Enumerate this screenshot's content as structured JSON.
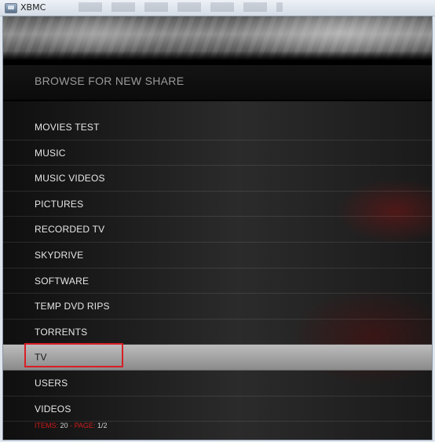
{
  "window": {
    "title": "XBMC"
  },
  "dialog": {
    "title": "BROWSE FOR NEW SHARE"
  },
  "list": {
    "items": [
      {
        "label": "MOVIES TEST"
      },
      {
        "label": "MUSIC"
      },
      {
        "label": "MUSIC VIDEOS"
      },
      {
        "label": "PICTURES"
      },
      {
        "label": "RECORDED TV"
      },
      {
        "label": "SKYDRIVE"
      },
      {
        "label": "SOFTWARE"
      },
      {
        "label": "TEMP DVD RIPS"
      },
      {
        "label": "TORRENTS"
      },
      {
        "label": "TV",
        "selected": true
      },
      {
        "label": "USERS"
      },
      {
        "label": "VIDEOS"
      }
    ]
  },
  "footer": {
    "items_label": "ITEMS:",
    "items_value": "20",
    "separator": "-",
    "page_label": "PAGE:",
    "page_value": "1/2"
  },
  "colors": {
    "accent": "#d81e26"
  }
}
